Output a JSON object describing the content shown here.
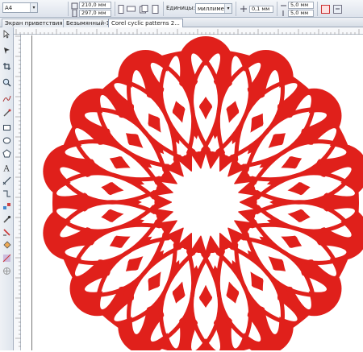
{
  "property_bar": {
    "page_size_value": "A4",
    "width_value": "210,0 мм",
    "height_value": "297,0 мм",
    "units_label": "Единицы:",
    "units_value": "миллиме...",
    "nudge_value": "0,1 мм",
    "dup_x_value": "5,0 мм",
    "dup_y_value": "5,0 мм"
  },
  "tabs": [
    {
      "label": "Экран приветствия"
    },
    {
      "label": "Безымянный-1"
    },
    {
      "label": "Corel cyclic patterns 2..."
    }
  ],
  "toolbox_tools": [
    "pick-tool-icon",
    "shape-tool-icon",
    "crop-tool-icon",
    "zoom-tool-icon",
    "freehand-tool-icon",
    "smart-fill-tool-icon",
    "rectangle-tool-icon",
    "ellipse-tool-icon",
    "polygon-tool-icon",
    "text-tool-icon",
    "parallel-dimension-tool-icon",
    "connector-tool-icon",
    "blend-tool-icon",
    "eyedropper-tool-icon",
    "outline-pen-tool-icon",
    "fill-tool-icon",
    "interactive-fill-tool-icon",
    "smart-drawing-tool-icon",
    "add-tool-icon"
  ],
  "colors": {
    "pattern_red": "#e0201b",
    "chrome_blue": "#dde3ec"
  }
}
